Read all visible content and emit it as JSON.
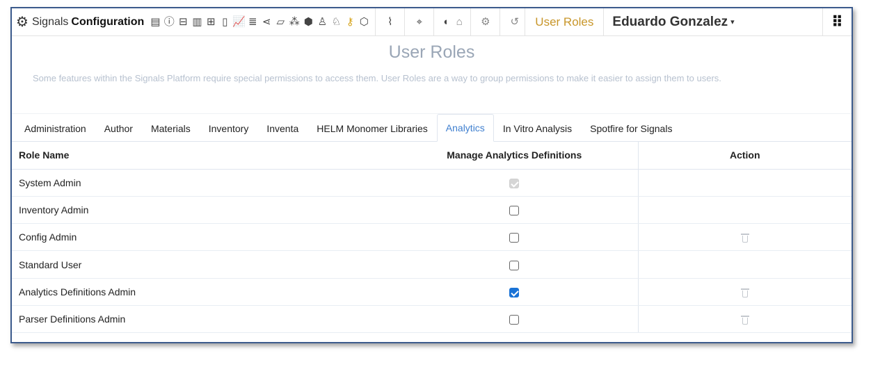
{
  "header": {
    "brand_prefix": "Signals",
    "brand_name": "Configuration",
    "active_page": "User Roles",
    "user_name": "Eduardo Gonzalez"
  },
  "toolbar_icons": [
    {
      "name": "calculator-icon",
      "glyph": "▤"
    },
    {
      "name": "info-icon",
      "glyph": "ⓘ"
    },
    {
      "name": "table-icon",
      "glyph": "⊟"
    },
    {
      "name": "document-list-icon",
      "glyph": "▥"
    },
    {
      "name": "grid-table-icon",
      "glyph": "⊞"
    },
    {
      "name": "file-icon",
      "glyph": "▯"
    },
    {
      "name": "bar-chart-icon",
      "glyph": "📈"
    },
    {
      "name": "database-icon",
      "glyph": "≣"
    },
    {
      "name": "share-icon",
      "glyph": "⋖"
    },
    {
      "name": "file-settings-icon",
      "glyph": "▱"
    },
    {
      "name": "molecule-icon",
      "glyph": "⁂"
    },
    {
      "name": "hexagon-icon",
      "glyph": "⬢"
    },
    {
      "name": "users-icon",
      "glyph": "♙"
    },
    {
      "name": "user-icon",
      "glyph": "♘"
    },
    {
      "name": "key-icon",
      "glyph": "⚷"
    },
    {
      "name": "cube-icon",
      "glyph": "⬡"
    }
  ],
  "page": {
    "title": "User Roles",
    "description": "Some features within the Signals Platform require special permissions to access them. User Roles are a way to group permissions to make it easier to assign them to users."
  },
  "tabs": [
    {
      "label": "Administration",
      "active": false
    },
    {
      "label": "Author",
      "active": false
    },
    {
      "label": "Materials",
      "active": false
    },
    {
      "label": "Inventory",
      "active": false
    },
    {
      "label": "Inventa",
      "active": false
    },
    {
      "label": "HELM Monomer Libraries",
      "active": false
    },
    {
      "label": "Analytics",
      "active": true
    },
    {
      "label": "In Vitro Analysis",
      "active": false
    },
    {
      "label": "Spotfire for Signals",
      "active": false
    }
  ],
  "table": {
    "columns": [
      "Role Name",
      "Manage Analytics Definitions",
      "Action"
    ],
    "rows": [
      {
        "role": "System Admin",
        "state": "disabled-checked",
        "deletable": false
      },
      {
        "role": "Inventory Admin",
        "state": "unchecked",
        "deletable": false
      },
      {
        "role": "Config Admin",
        "state": "unchecked",
        "deletable": true
      },
      {
        "role": "Standard User",
        "state": "unchecked",
        "deletable": false
      },
      {
        "role": "Analytics Definitions Admin",
        "state": "checked",
        "deletable": true
      },
      {
        "role": "Parser Definitions Admin",
        "state": "unchecked",
        "deletable": true
      }
    ]
  },
  "colors": {
    "active_tab": "#3f7fcf",
    "active_nav": "#c8962a",
    "checkbox_checked": "#1a73d6",
    "title": "#9aa6b6"
  }
}
